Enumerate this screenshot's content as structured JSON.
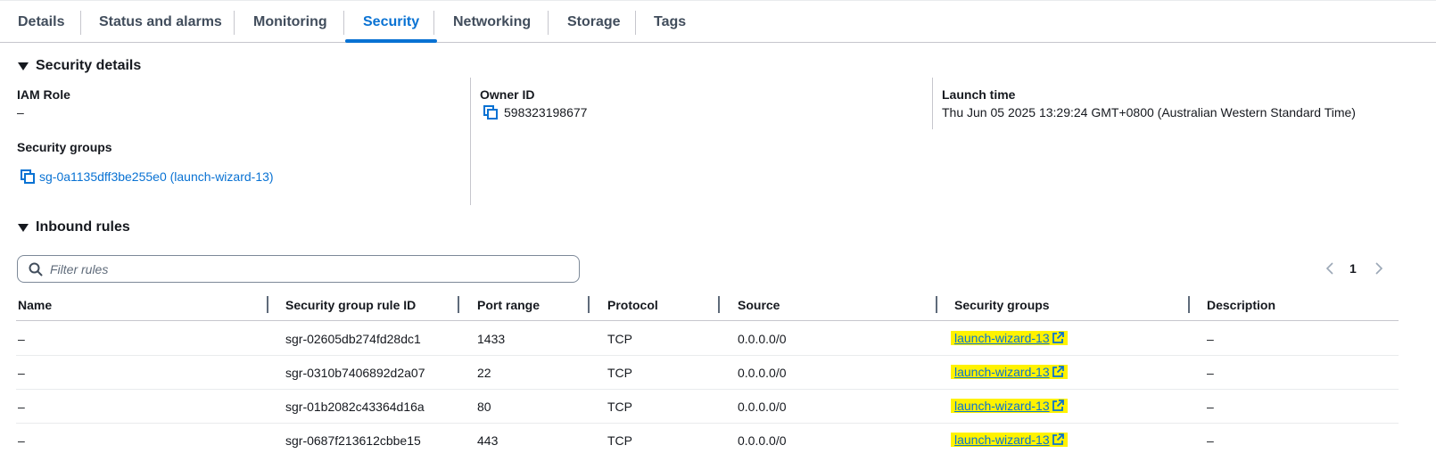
{
  "tabs": [
    "Details",
    "Status and alarms",
    "Monitoring",
    "Security",
    "Networking",
    "Storage",
    "Tags"
  ],
  "active_tab": "Security",
  "security_details": {
    "title": "Security details",
    "iam_role_label": "IAM Role",
    "iam_role_value": "–",
    "owner_id_label": "Owner ID",
    "owner_id_value": "598323198677",
    "launch_time_label": "Launch time",
    "launch_time_value": "Thu Jun 05 2025 13:29:24 GMT+0800 (Australian Western Standard Time)",
    "security_groups_label": "Security groups",
    "security_groups_value": "sg-0a1135dff3be255e0 (launch-wizard-13)"
  },
  "inbound_rules": {
    "title": "Inbound rules",
    "filter_placeholder": "Filter rules",
    "page_number": "1",
    "columns": [
      "Name",
      "Security group rule ID",
      "Port range",
      "Protocol",
      "Source",
      "Security groups",
      "Description"
    ],
    "rows": [
      {
        "name": "–",
        "rule_id": "sgr-02605db274fd28dc1",
        "port": "1433",
        "protocol": "TCP",
        "source": "0.0.0.0/0",
        "sg": "launch-wizard-13",
        "description": "–"
      },
      {
        "name": "–",
        "rule_id": "sgr-0310b7406892d2a07",
        "port": "22",
        "protocol": "TCP",
        "source": "0.0.0.0/0",
        "sg": "launch-wizard-13",
        "description": "–"
      },
      {
        "name": "–",
        "rule_id": "sgr-01b2082c43364d16a",
        "port": "80",
        "protocol": "TCP",
        "source": "0.0.0.0/0",
        "sg": "launch-wizard-13",
        "description": "–"
      },
      {
        "name": "–",
        "rule_id": "sgr-0687f213612cbbe15",
        "port": "443",
        "protocol": "TCP",
        "source": "0.0.0.0/0",
        "sg": "launch-wizard-13",
        "description": "–"
      }
    ]
  },
  "icons": {
    "copy": "copy-icon",
    "search": "search-icon",
    "external_link": "external-link-icon",
    "caret": "caret-down-icon",
    "chevron_left": "chevron-left-icon",
    "chevron_right": "chevron-right-icon"
  },
  "colors": {
    "link": "#0972d3",
    "highlight": "#fff200",
    "text": "#16191f"
  }
}
